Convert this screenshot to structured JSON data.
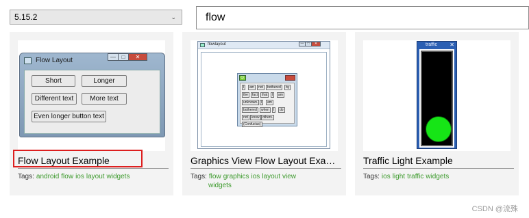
{
  "version_select": {
    "value": "5.15.2",
    "chevron": "chevron-down-icon"
  },
  "search": {
    "value": "flow"
  },
  "examples": [
    {
      "title": "Flow Layout Example",
      "tags_label": "Tags:",
      "tags": [
        "android",
        "flow",
        "ios",
        "layout",
        "widgets"
      ],
      "thumb": {
        "window_title": "Flow Layout",
        "buttons": [
          "Short",
          "Longer",
          "Different text",
          "More text",
          "Even longer button text"
        ]
      }
    },
    {
      "title": "Graphics View Flow Layout Example",
      "tags_label": "Tags:",
      "tags": [
        "flow",
        "graphics",
        "ios",
        "layout",
        "view",
        "widgets"
      ],
      "thumb": {
        "window_title": "flowlayout",
        "inner_icon": "Qt",
        "words": [
          "I",
          "am",
          "not",
          "bothered",
          "by",
          "the",
          "fact",
          "that",
          "I",
          "am",
          "unknown.",
          "I",
          "am",
          "bothered",
          "when",
          "I",
          "do",
          "not",
          "know",
          "others.",
          "(Confucius)"
        ]
      }
    },
    {
      "title": "Traffic Light Example",
      "tags_label": "Tags:",
      "tags": [
        "ios",
        "light",
        "traffic",
        "widgets"
      ],
      "thumb": {
        "window_title": "traffic",
        "close_glyph": "✕",
        "lamp_color": "#16e516"
      }
    }
  ],
  "window_controls": {
    "minimize": "—",
    "maximize": "□",
    "close": "✕"
  },
  "watermark": "CSDN @流殊",
  "colors": {
    "tag": "#3c9a2c",
    "highlight": "#dd1f1f",
    "card_bg": "#f3f3f3"
  }
}
